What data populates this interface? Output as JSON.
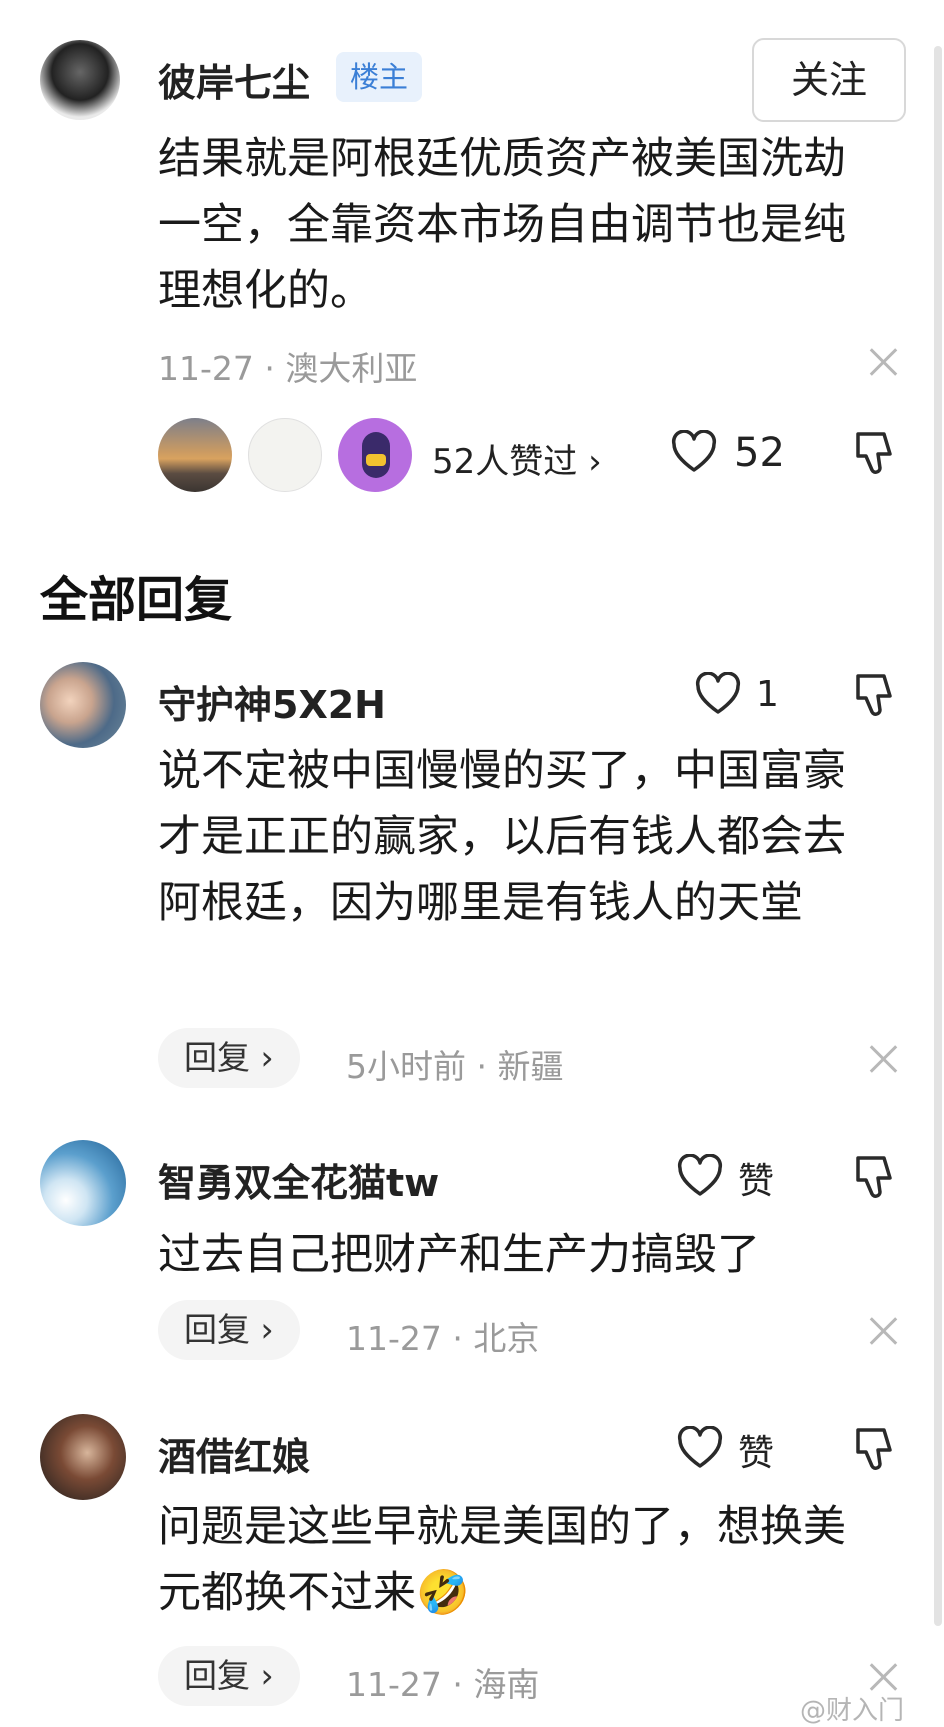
{
  "post": {
    "author": "彼岸七尘",
    "badge": "楼主",
    "follow_label": "关注",
    "content": "结果就是阿根廷优质资产被美国洗劫一空，全靠资本市场自由调节也是纯理想化的。",
    "meta": "11-27 · 澳大利亚",
    "likers_text": "52人赞过 ›",
    "like_count": "52"
  },
  "replies_section_title": "全部回复",
  "comments": [
    {
      "author": "守护神5X2H",
      "like_text": "1",
      "content": "说不定被中国慢慢的买了，中国富豪才是正正的赢家，以后有钱人都会去阿根廷，因为哪里是有钱人的天堂",
      "reply_label": "回复 ›",
      "meta": "5小时前 · 新疆"
    },
    {
      "author": "智勇双全花猫tw",
      "like_text": "赞",
      "content": "过去自己把财产和生产力搞毁了",
      "reply_label": "回复 ›",
      "meta": "11-27 · 北京"
    },
    {
      "author": "酒借红娘",
      "like_text": "赞",
      "content": "问题是这些早就是美国的了，想换美元都换不过来",
      "emoji": "🤣",
      "reply_label": "回复 ›",
      "meta": "11-27 · 海南"
    }
  ],
  "watermark": "@财入门",
  "icons": {
    "like": "heart-outline-icon",
    "dislike": "thumbs-down-icon",
    "close": "close-icon"
  }
}
